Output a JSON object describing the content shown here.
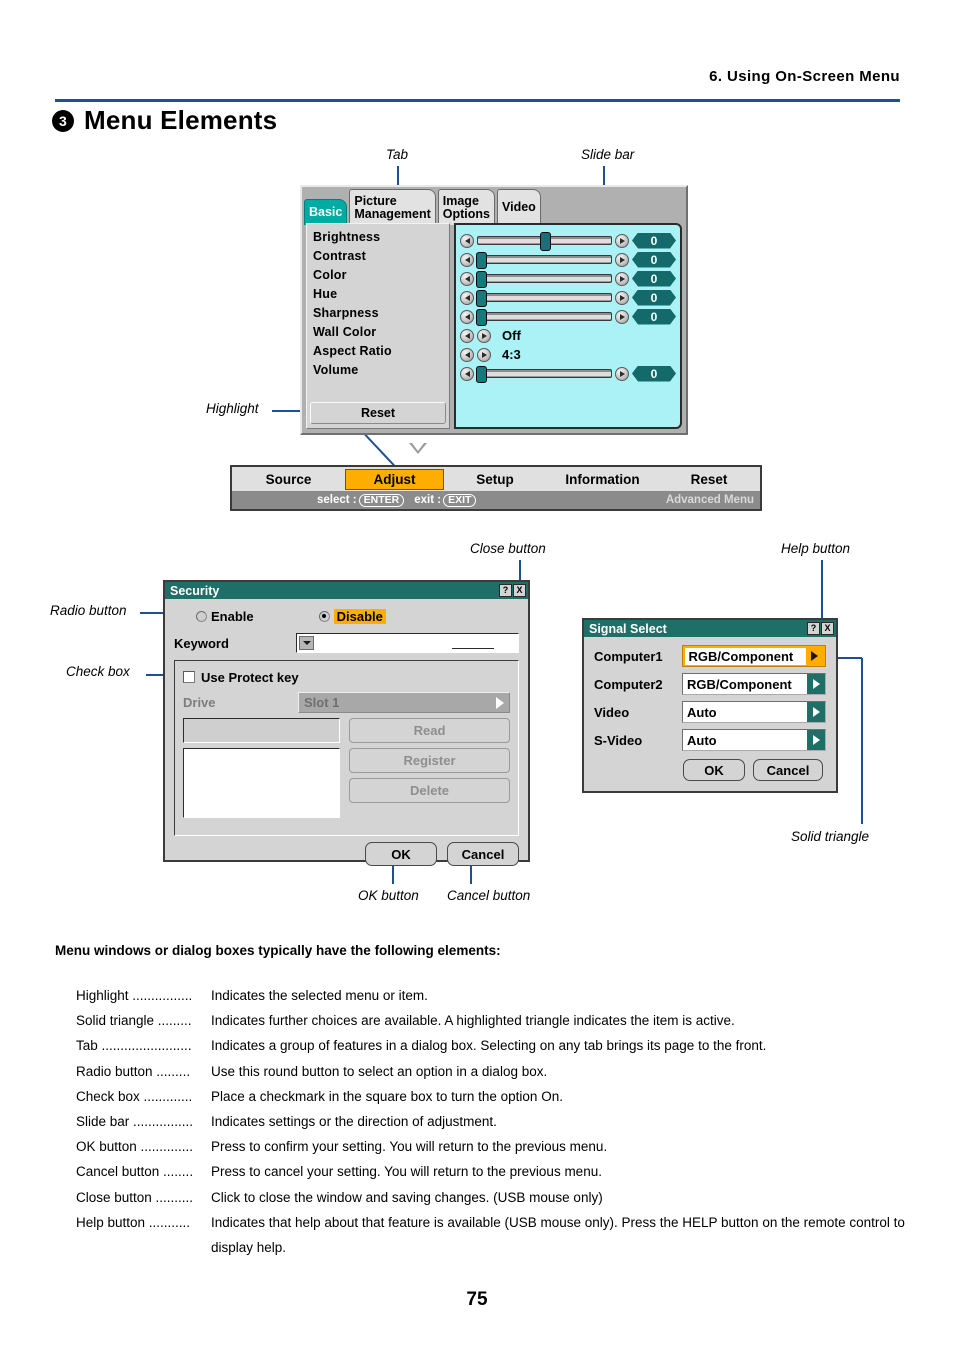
{
  "header": {
    "chapter": "6. Using On-Screen Menu"
  },
  "page_title": {
    "number": "3",
    "text": "Menu Elements"
  },
  "callouts": {
    "tab": "Tab",
    "slide_bar": "Slide bar",
    "highlight": "Highlight",
    "close_button": "Close button",
    "help_button": "Help button",
    "radio_button": "Radio button",
    "check_box": "Check box",
    "ok_button": "OK button",
    "cancel_button": "Cancel button",
    "solid_triangle": "Solid triangle"
  },
  "osd_menu": {
    "tabs": [
      {
        "lines": [
          "Basic"
        ],
        "selected": true
      },
      {
        "lines": [
          "Picture",
          "Management"
        ],
        "selected": false
      },
      {
        "lines": [
          "Image",
          "Options"
        ],
        "selected": false
      },
      {
        "lines": [
          "Video"
        ],
        "selected": false
      }
    ],
    "items": [
      "Brightness",
      "Contrast",
      "Color",
      "Hue",
      "Sharpness",
      "Wall Color",
      "Aspect Ratio",
      "Volume"
    ],
    "reset_label": "Reset",
    "values": {
      "brightness": "0",
      "contrast": "0",
      "color": "0",
      "hue": "0",
      "sharpness": "0",
      "wall_color": "Off",
      "aspect_ratio": "4:3",
      "volume": "0"
    },
    "slider_positions": {
      "brightness_pct": 50,
      "contrast_pct": 2,
      "color_pct": 2,
      "hue_pct": 2,
      "sharpness_pct": 2,
      "volume_pct": 2
    }
  },
  "osd_bar": {
    "items": [
      {
        "label": "Source",
        "highlighted": false
      },
      {
        "label": "Adjust",
        "highlighted": true
      },
      {
        "label": "Setup",
        "highlighted": false
      },
      {
        "label": "Information",
        "highlighted": false
      },
      {
        "label": "Reset",
        "highlighted": false
      }
    ],
    "select_label": "select :",
    "select_key": "ENTER",
    "exit_label": "exit :",
    "exit_key": "EXIT",
    "advanced_label": "Advanced Menu"
  },
  "security_dialog": {
    "title": "Security",
    "help_btn": "?",
    "close_btn": "X",
    "enable_label": "Enable",
    "disable_label": "Disable",
    "keyword_label": "Keyword",
    "keyword_value": "",
    "use_protect_key_label": "Use Protect key",
    "drive_label": "Drive",
    "drive_value": "Slot 1",
    "read_label": "Read",
    "register_label": "Register",
    "delete_label": "Delete",
    "ok_label": "OK",
    "cancel_label": "Cancel"
  },
  "signal_dialog": {
    "title": "Signal Select",
    "help_btn": "?",
    "close_btn": "X",
    "rows": [
      {
        "label": "Computer1",
        "value": "RGB/Component",
        "selected": true
      },
      {
        "label": "Computer2",
        "value": "RGB/Component",
        "selected": false
      },
      {
        "label": "Video",
        "value": "Auto",
        "selected": false
      },
      {
        "label": "S-Video",
        "value": "Auto",
        "selected": false
      }
    ],
    "ok_label": "OK",
    "cancel_label": "Cancel"
  },
  "description": {
    "intro": "Menu windows or dialog boxes typically have the following elements:",
    "rows": [
      {
        "term": "Highlight ................",
        "def": "Indicates the selected menu or item."
      },
      {
        "term": "Solid triangle .........",
        "def": "Indicates further choices are available. A highlighted triangle indicates the item is active."
      },
      {
        "term": "Tab ........................",
        "def": "Indicates a group of features in a dialog box. Selecting on any tab brings its page to the front."
      },
      {
        "term": "Radio button .........",
        "def": "Use this round button to select an option in a dialog box."
      },
      {
        "term": "Check box .............",
        "def": "Place a checkmark in the square box to turn the option On."
      },
      {
        "term": "Slide bar ................",
        "def": "Indicates settings or the direction of adjustment."
      },
      {
        "term": "OK button ..............",
        "def": "Press to confirm your setting. You will return to the previous menu."
      },
      {
        "term": "Cancel button ........",
        "def": "Press to cancel your setting. You will return to the previous menu."
      },
      {
        "term": "Close button ..........",
        "def": "Click to close the window and saving changes. (USB mouse only)"
      },
      {
        "term": "Help button ...........",
        "def": "Indicates that help about that feature is available (USB mouse only). Press the HELP button on the remote control to display help."
      }
    ]
  },
  "page_number": "75",
  "colors": {
    "rule": "#1d4f91",
    "tab_selected": "#00aba3",
    "highlight_orange": "#ffae00",
    "titlebar_teal": "#1f6e68",
    "osd_panel_cyan": "#aaf2f5",
    "value_box_teal": "#14696b"
  }
}
